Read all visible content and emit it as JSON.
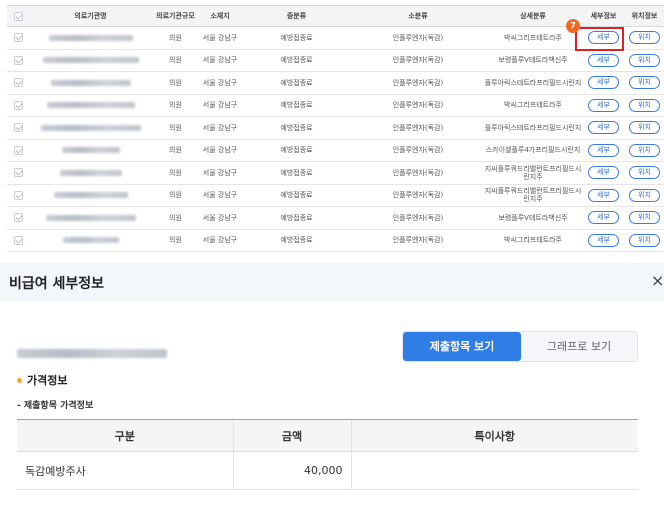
{
  "list": {
    "headers": [
      "의료기관명",
      "의료기관규모",
      "소재지",
      "중분류",
      "소분류",
      "상세분류",
      "세부정보",
      "위치정보"
    ],
    "rows": [
      {
        "scale": "의원",
        "location": "서울 강남구",
        "mid": "예방접종료",
        "small": "인플루엔자(독감)",
        "detail": "박씨그리프테트라주"
      },
      {
        "scale": "의원",
        "location": "서울 강남구",
        "mid": "예방접종료",
        "small": "인플루엔자(독감)",
        "detail": "보령플루V테트라백신주"
      },
      {
        "scale": "의원",
        "location": "서울 강남구",
        "mid": "예방접종료",
        "small": "인플루엔자(독감)",
        "detail": "플루아릭스테트라프리필드시린지"
      },
      {
        "scale": "의원",
        "location": "서울 강남구",
        "mid": "예방접종료",
        "small": "인플루엔자(독감)",
        "detail": "박씨그리프테트라주"
      },
      {
        "scale": "의원",
        "location": "서울 강남구",
        "mid": "예방접종료",
        "small": "인플루엔자(독감)",
        "detail": "플루아릭스테트라프리필드시린지"
      },
      {
        "scale": "의원",
        "location": "서울 강남구",
        "mid": "예방접종료",
        "small": "인플루엔자(독감)",
        "detail": "스카이셀플루4가프리필드시린지"
      },
      {
        "scale": "의원",
        "location": "서울 강남구",
        "mid": "예방접종료",
        "small": "인플루엔자(독감)",
        "detail": "지씨플루쿼드리밸런트프리필드시린지주"
      },
      {
        "scale": "의원",
        "location": "서울 강남구",
        "mid": "예방접종료",
        "small": "인플루엔자(독감)",
        "detail": "지씨플루쿼드리밸런트프리필드시린지주"
      },
      {
        "scale": "의원",
        "location": "서울 강남구",
        "mid": "예방접종료",
        "small": "인플루엔자(독감)",
        "detail": "보령플루V테트라백신주"
      },
      {
        "scale": "의원",
        "location": "서울 강남구",
        "mid": "예방접종료",
        "small": "인플루엔자(독감)",
        "detail": "박씨그리프테트라주"
      }
    ],
    "detail_btn": "세부",
    "location_btn": "위치",
    "step_badge": "7"
  },
  "modal": {
    "title": "비급여 세부정보",
    "close": "×",
    "tabs": [
      "제출항목 보기",
      "그래프로 보기"
    ],
    "section_title": "가격정보",
    "subsection_title": "- 제출항목 가격정보",
    "table": {
      "headers": [
        "구분",
        "금액",
        "특이사항"
      ],
      "rows": [
        [
          "독감예방주사",
          "40,000",
          ""
        ]
      ]
    }
  },
  "colors": {
    "accent": "#2f7ee6",
    "highlight": "#e0202a",
    "badge": "#f06a22",
    "section_dot": "#f5a623"
  }
}
